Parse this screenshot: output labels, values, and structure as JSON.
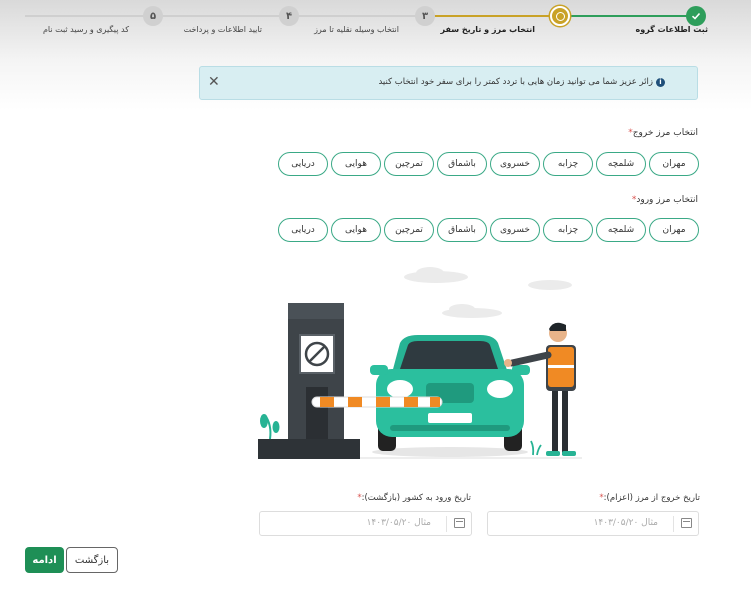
{
  "stepper": {
    "steps": [
      {
        "number": "",
        "label": "ثبت اطلاعات گروه",
        "status": "done"
      },
      {
        "number": "",
        "label": "انتخاب مرز و تاریخ سفر",
        "status": "active"
      },
      {
        "number": "۳",
        "label": "انتخاب وسیله نقلیه تا مرز",
        "status": "pending"
      },
      {
        "number": "۴",
        "label": "تایید اطلاعات و پرداخت",
        "status": "pending"
      },
      {
        "number": "۵",
        "label": "کد پیگیری و رسید ثبت نام",
        "status": "pending"
      }
    ]
  },
  "alert": {
    "text": "زائر عزیز شما می توانید زمان هایی با تردد کمتر را برای سفر خود انتخاب کنید",
    "info_icon": "i"
  },
  "exit_border": {
    "label": "انتخاب مرز خروج",
    "required_mark": "*",
    "options": [
      "مهران",
      "شلمچه",
      "چزابه",
      "خسروی",
      "باشماق",
      "تمرچین",
      "هوایی",
      "دریایی"
    ]
  },
  "entry_border": {
    "label": "انتخاب مرز ورود",
    "required_mark": "*",
    "options": [
      "مهران",
      "شلمچه",
      "چزابه",
      "خسروی",
      "باشماق",
      "تمرچین",
      "هوایی",
      "دریایی"
    ]
  },
  "exit_date": {
    "label": "تاریخ خروج از مرز (اعزام):",
    "required_mark": "*",
    "placeholder": "مثال ۱۴۰۳/۰۵/۲۰"
  },
  "entry_date": {
    "label": "تاریخ ورود به کشور (بازگشت):",
    "required_mark": "*",
    "placeholder": "مثال ۱۴۰۳/۰۵/۲۰"
  },
  "buttons": {
    "continue": "ادامه",
    "back": "بازگشت"
  },
  "colors": {
    "accent_green": "#1e8f56",
    "chip_border": "#3aa986",
    "active_step": "#c9a227",
    "alert_bg": "#d8eef2",
    "car_teal": "#27b394"
  }
}
